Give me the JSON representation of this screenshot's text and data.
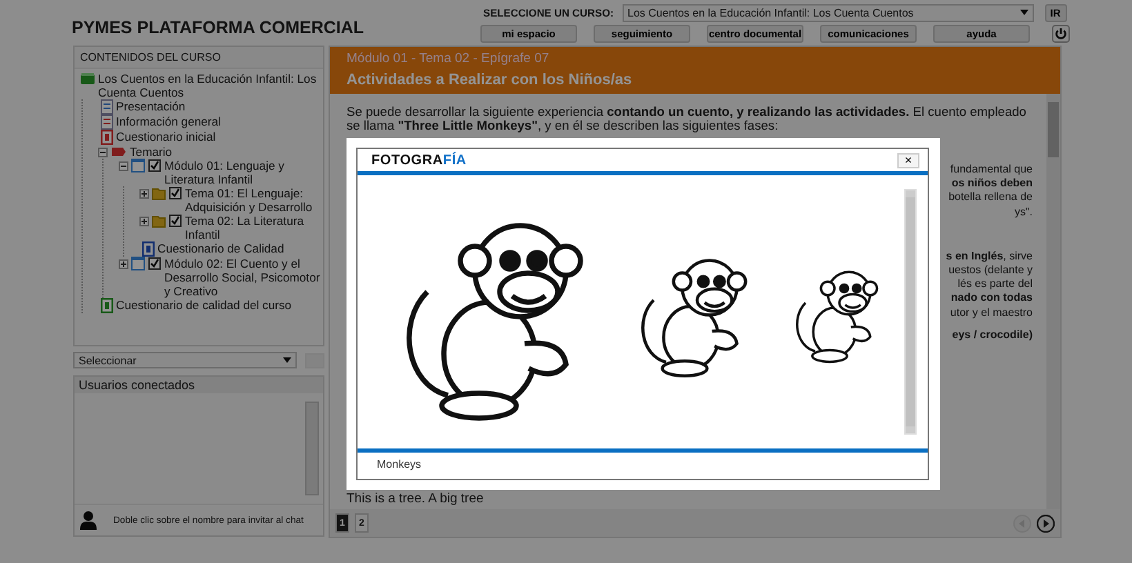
{
  "header": {
    "title": "PYMES PLATAFORMA COMERCIAL",
    "course_label": "SELECCIONE UN CURSO:",
    "course_select": "Los Cuentos en la Educación Infantil: Los Cuenta Cuentos",
    "go_button": "IR",
    "nav": [
      "mi espacio",
      "seguimiento",
      "centro documental",
      "comunicaciones",
      "ayuda"
    ]
  },
  "sidebar": {
    "title": "CONTENIDOS DEL CURSO",
    "tree": [
      {
        "label": "Los Cuentos en la Educación Infantil: Los Cuenta Cuentos",
        "kind": "course",
        "children": [
          {
            "label": "Presentación",
            "kind": "page"
          },
          {
            "label": "Información general",
            "kind": "info"
          },
          {
            "label": "Cuestionario inicial",
            "kind": "pretest"
          },
          {
            "label": "Temario",
            "kind": "section",
            "expanded": true,
            "children": [
              {
                "label": "Módulo 01: Lenguaje y Literatura Infantil",
                "kind": "module",
                "expanded": true,
                "children": [
                  {
                    "label": "Tema 01: El Lenguaje: Adquisición y Desarrollo",
                    "kind": "topic",
                    "expanded": false
                  },
                  {
                    "label": "Tema 02: La Literatura Infantil",
                    "kind": "topic",
                    "expanded": false
                  },
                  {
                    "label": "Cuestionario de Calidad",
                    "kind": "quiz"
                  }
                ]
              },
              {
                "label": "Módulo 02: El Cuento y el Desarrollo Social, Psicomotor y Creativo",
                "kind": "module",
                "expanded": false
              }
            ]
          },
          {
            "label": "Cuestionario de calidad del curso",
            "kind": "survey"
          }
        ]
      }
    ],
    "filter_select": "Seleccionar",
    "users_title": "Usuarios conectados",
    "chat_hint": "Doble clic sobre el nombre para invitar al chat"
  },
  "lesson": {
    "breadcrumb": "Módulo 01 - Tema 02 - Epígrafe 07",
    "title": "Actividades a Realizar con los Niños/as",
    "intro": "Se puede desarrollar la siguiente experiencia **contando un cuento, y realizando las actividades.** El cuento empleado se llama **\"Three Little Monkeys\"**, y en él se describen las siguientes fases:",
    "fragments": [
      [
        {
          "text": "fundamental que",
          "bold": false
        },
        {
          "text": "os niños deben",
          "bold": true
        },
        {
          "text": "botella rellena de",
          "bold": false
        },
        {
          "text": "ys\".",
          "bold": false
        }
      ],
      [
        {
          "text": "**s en Inglés**, sirve",
          "bold": false
        },
        {
          "text": "uestos (delante y",
          "bold": false
        },
        {
          "text": "lés es parte del",
          "bold": false
        },
        {
          "text": "nado con todas",
          "bold": true
        },
        {
          "text": "utor y el maestro",
          "bold": false
        }
      ],
      [
        {
          "text": "eys / crocodile)",
          "bold": true
        }
      ]
    ],
    "last_line": "This is a tree. A big tree",
    "pages": [
      {
        "label": "1",
        "selected": true
      },
      {
        "label": "2",
        "selected": false
      }
    ]
  },
  "dialog": {
    "logo_left": "FOTOGRA",
    "logo_right": "FÍA",
    "close": "×",
    "caption": "Monkeys"
  }
}
